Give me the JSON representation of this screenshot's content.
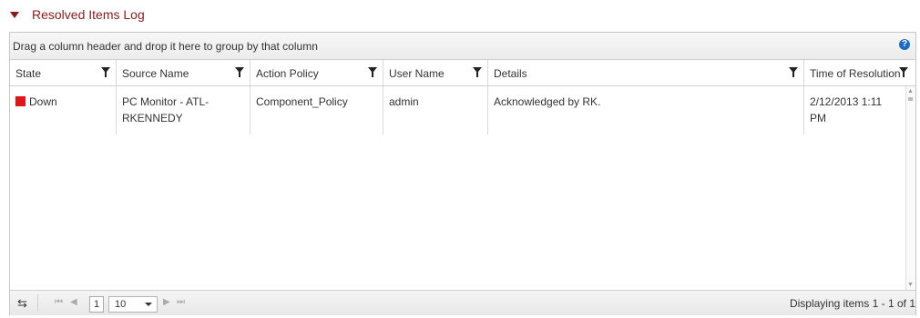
{
  "section": {
    "title": "Resolved Items Log"
  },
  "grid": {
    "group_hint": "Drag a column header and drop it here to group by that column",
    "help_glyph": "?",
    "columns": [
      {
        "label": "State"
      },
      {
        "label": "Source Name"
      },
      {
        "label": "Action Policy"
      },
      {
        "label": "User Name"
      },
      {
        "label": "Details"
      },
      {
        "label": "Time of Resolution"
      }
    ],
    "rows": [
      {
        "state": "Down",
        "state_color": "#e01515",
        "source_name": "PC Monitor - ATL-RKENNEDY",
        "action_policy": "Component_Policy",
        "user_name": "admin",
        "details": "Acknowledged by RK.",
        "time_of_resolution": "2/12/2013 1:11 PM"
      }
    ]
  },
  "pager": {
    "refresh_glyph": "⇆",
    "first_glyph": "⏮",
    "prev_glyph": "◀",
    "next_glyph": "▶",
    "last_glyph": "⏭",
    "current_page": "1",
    "page_size": "10",
    "info": "Displaying items 1 - 1 of 1"
  },
  "colors": {
    "accent": "#8b1a1a",
    "help": "#1b6bc7",
    "state_down": "#e01515"
  }
}
